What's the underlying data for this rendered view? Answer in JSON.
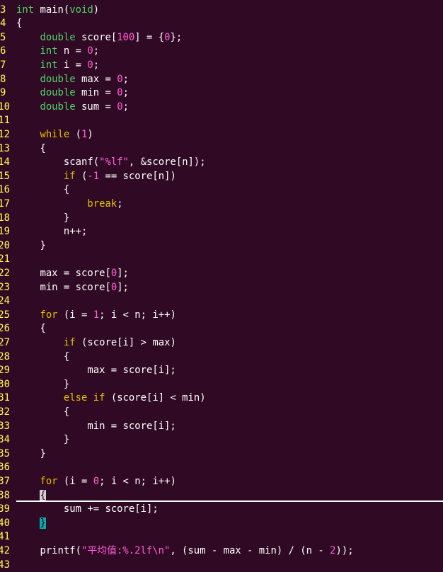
{
  "editor": {
    "lines": [
      {
        "n": "3",
        "tokens": [
          {
            "t": "int",
            "c": "type"
          },
          {
            "t": " main(",
            "c": "def"
          },
          {
            "t": "void",
            "c": "type"
          },
          {
            "t": ")",
            "c": "def"
          }
        ]
      },
      {
        "n": "4",
        "tokens": [
          {
            "t": "{",
            "c": "def"
          }
        ]
      },
      {
        "n": "5",
        "tokens": [
          {
            "t": "    ",
            "c": "def"
          },
          {
            "t": "double",
            "c": "type"
          },
          {
            "t": " score[",
            "c": "def"
          },
          {
            "t": "100",
            "c": "num"
          },
          {
            "t": "] = {",
            "c": "def"
          },
          {
            "t": "0",
            "c": "num"
          },
          {
            "t": "};",
            "c": "def"
          }
        ]
      },
      {
        "n": "6",
        "tokens": [
          {
            "t": "    ",
            "c": "def"
          },
          {
            "t": "int",
            "c": "type"
          },
          {
            "t": " n = ",
            "c": "def"
          },
          {
            "t": "0",
            "c": "num"
          },
          {
            "t": ";",
            "c": "def"
          }
        ]
      },
      {
        "n": "7",
        "tokens": [
          {
            "t": "    ",
            "c": "def"
          },
          {
            "t": "int",
            "c": "type"
          },
          {
            "t": " i = ",
            "c": "def"
          },
          {
            "t": "0",
            "c": "num"
          },
          {
            "t": ";",
            "c": "def"
          }
        ]
      },
      {
        "n": "8",
        "tokens": [
          {
            "t": "    ",
            "c": "def"
          },
          {
            "t": "double",
            "c": "type"
          },
          {
            "t": " max = ",
            "c": "def"
          },
          {
            "t": "0",
            "c": "num"
          },
          {
            "t": ";",
            "c": "def"
          }
        ]
      },
      {
        "n": "9",
        "tokens": [
          {
            "t": "    ",
            "c": "def"
          },
          {
            "t": "double",
            "c": "type"
          },
          {
            "t": " min = ",
            "c": "def"
          },
          {
            "t": "0",
            "c": "num"
          },
          {
            "t": ";",
            "c": "def"
          }
        ]
      },
      {
        "n": "10",
        "tokens": [
          {
            "t": "    ",
            "c": "def"
          },
          {
            "t": "double",
            "c": "type"
          },
          {
            "t": " sum = ",
            "c": "def"
          },
          {
            "t": "0",
            "c": "num"
          },
          {
            "t": ";",
            "c": "def"
          }
        ]
      },
      {
        "n": "11",
        "tokens": []
      },
      {
        "n": "12",
        "tokens": [
          {
            "t": "    ",
            "c": "def"
          },
          {
            "t": "while",
            "c": "kw"
          },
          {
            "t": " (",
            "c": "def"
          },
          {
            "t": "1",
            "c": "num"
          },
          {
            "t": ")",
            "c": "def"
          }
        ]
      },
      {
        "n": "13",
        "tokens": [
          {
            "t": "    {",
            "c": "def"
          }
        ]
      },
      {
        "n": "14",
        "tokens": [
          {
            "t": "        scanf(",
            "c": "def"
          },
          {
            "t": "\"%lf\"",
            "c": "str"
          },
          {
            "t": ", &score[n]);",
            "c": "def"
          }
        ]
      },
      {
        "n": "15",
        "tokens": [
          {
            "t": "        ",
            "c": "def"
          },
          {
            "t": "if",
            "c": "kw"
          },
          {
            "t": " (",
            "c": "def"
          },
          {
            "t": "-1",
            "c": "num"
          },
          {
            "t": " == score[n])",
            "c": "def"
          }
        ]
      },
      {
        "n": "16",
        "tokens": [
          {
            "t": "        {",
            "c": "def"
          }
        ]
      },
      {
        "n": "17",
        "tokens": [
          {
            "t": "            ",
            "c": "def"
          },
          {
            "t": "break",
            "c": "kw"
          },
          {
            "t": ";",
            "c": "def"
          }
        ]
      },
      {
        "n": "18",
        "tokens": [
          {
            "t": "        }",
            "c": "def"
          }
        ]
      },
      {
        "n": "19",
        "tokens": [
          {
            "t": "        n++;",
            "c": "def"
          }
        ]
      },
      {
        "n": "20",
        "tokens": [
          {
            "t": "    }",
            "c": "def"
          }
        ]
      },
      {
        "n": "21",
        "tokens": []
      },
      {
        "n": "22",
        "tokens": [
          {
            "t": "    max = score[",
            "c": "def"
          },
          {
            "t": "0",
            "c": "num"
          },
          {
            "t": "];",
            "c": "def"
          }
        ]
      },
      {
        "n": "23",
        "tokens": [
          {
            "t": "    min = score[",
            "c": "def"
          },
          {
            "t": "0",
            "c": "num"
          },
          {
            "t": "];",
            "c": "def"
          }
        ]
      },
      {
        "n": "24",
        "tokens": []
      },
      {
        "n": "25",
        "tokens": [
          {
            "t": "    ",
            "c": "def"
          },
          {
            "t": "for",
            "c": "kw"
          },
          {
            "t": " (i = ",
            "c": "def"
          },
          {
            "t": "1",
            "c": "num"
          },
          {
            "t": "; i < n; i++)",
            "c": "def"
          }
        ]
      },
      {
        "n": "26",
        "tokens": [
          {
            "t": "    {",
            "c": "def"
          }
        ]
      },
      {
        "n": "27",
        "tokens": [
          {
            "t": "        ",
            "c": "def"
          },
          {
            "t": "if",
            "c": "kw"
          },
          {
            "t": " (score[i] > max)",
            "c": "def"
          }
        ]
      },
      {
        "n": "28",
        "tokens": [
          {
            "t": "        {",
            "c": "def"
          }
        ]
      },
      {
        "n": "29",
        "tokens": [
          {
            "t": "            max = score[i];",
            "c": "def"
          }
        ]
      },
      {
        "n": "30",
        "tokens": [
          {
            "t": "        }",
            "c": "def"
          }
        ]
      },
      {
        "n": "31",
        "tokens": [
          {
            "t": "        ",
            "c": "def"
          },
          {
            "t": "else",
            "c": "kw"
          },
          {
            "t": " ",
            "c": "def"
          },
          {
            "t": "if",
            "c": "kw"
          },
          {
            "t": " (score[i] < min)",
            "c": "def"
          }
        ]
      },
      {
        "n": "32",
        "tokens": [
          {
            "t": "        {",
            "c": "def"
          }
        ]
      },
      {
        "n": "33",
        "tokens": [
          {
            "t": "            min = score[i];",
            "c": "def"
          }
        ]
      },
      {
        "n": "34",
        "tokens": [
          {
            "t": "        }",
            "c": "def"
          }
        ]
      },
      {
        "n": "35",
        "tokens": [
          {
            "t": "    }",
            "c": "def"
          }
        ]
      },
      {
        "n": "36",
        "tokens": []
      },
      {
        "n": "37",
        "tokens": [
          {
            "t": "    ",
            "c": "def"
          },
          {
            "t": "for",
            "c": "kw"
          },
          {
            "t": " (i = ",
            "c": "def"
          },
          {
            "t": "0",
            "c": "num"
          },
          {
            "t": "; i < n; i++)",
            "c": "def"
          }
        ]
      },
      {
        "n": "38",
        "tokens": [
          {
            "t": "    ",
            "c": "def"
          },
          {
            "t": "{",
            "c": "cursor"
          }
        ]
      },
      {
        "n": "39",
        "tokens": [
          {
            "t": "        sum += score[i];",
            "c": "def"
          }
        ]
      },
      {
        "n": "40",
        "tokens": [
          {
            "t": "    ",
            "c": "def"
          },
          {
            "t": "}",
            "c": "match"
          }
        ]
      },
      {
        "n": "41",
        "tokens": []
      },
      {
        "n": "42",
        "tokens": [
          {
            "t": "    printf(",
            "c": "def"
          },
          {
            "t": "\"平均值:%.2lf\\n\"",
            "c": "str"
          },
          {
            "t": ", (sum - max - min) / (n - ",
            "c": "def"
          },
          {
            "t": "2",
            "c": "num"
          },
          {
            "t": "));",
            "c": "def"
          }
        ]
      },
      {
        "n": "43",
        "tokens": []
      }
    ]
  }
}
